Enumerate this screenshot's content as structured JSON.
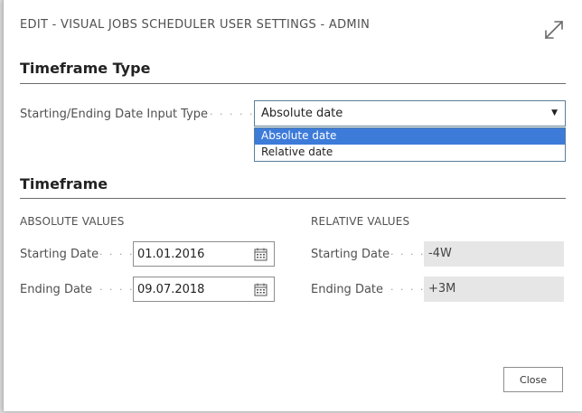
{
  "dialog": {
    "title": "EDIT - VISUAL JOBS SCHEDULER USER SETTINGS - ADMIN",
    "expand_icon": "expand-diagonal-arrows-icon"
  },
  "timeframe_type": {
    "section_title": "Timeframe Type",
    "field_label": "Starting/Ending Date Input Type",
    "selected_value": "Absolute date",
    "options": [
      "Absolute date",
      "Relative date"
    ],
    "highlight_color": "#3d7bd9"
  },
  "timeframe": {
    "section_title": "Timeframe",
    "absolute": {
      "heading": "ABSOLUTE VALUES",
      "starting_label": "Starting Date",
      "starting_value": "01.01.2016",
      "ending_label": "Ending Date",
      "ending_value": "09.07.2018",
      "calendar_icon": "calendar-icon"
    },
    "relative": {
      "heading": "RELATIVE VALUES",
      "starting_label": "Starting Date",
      "starting_value": "-4W",
      "ending_label": "Ending Date",
      "ending_value": "+3M"
    }
  },
  "footer": {
    "close_label": "Close"
  }
}
